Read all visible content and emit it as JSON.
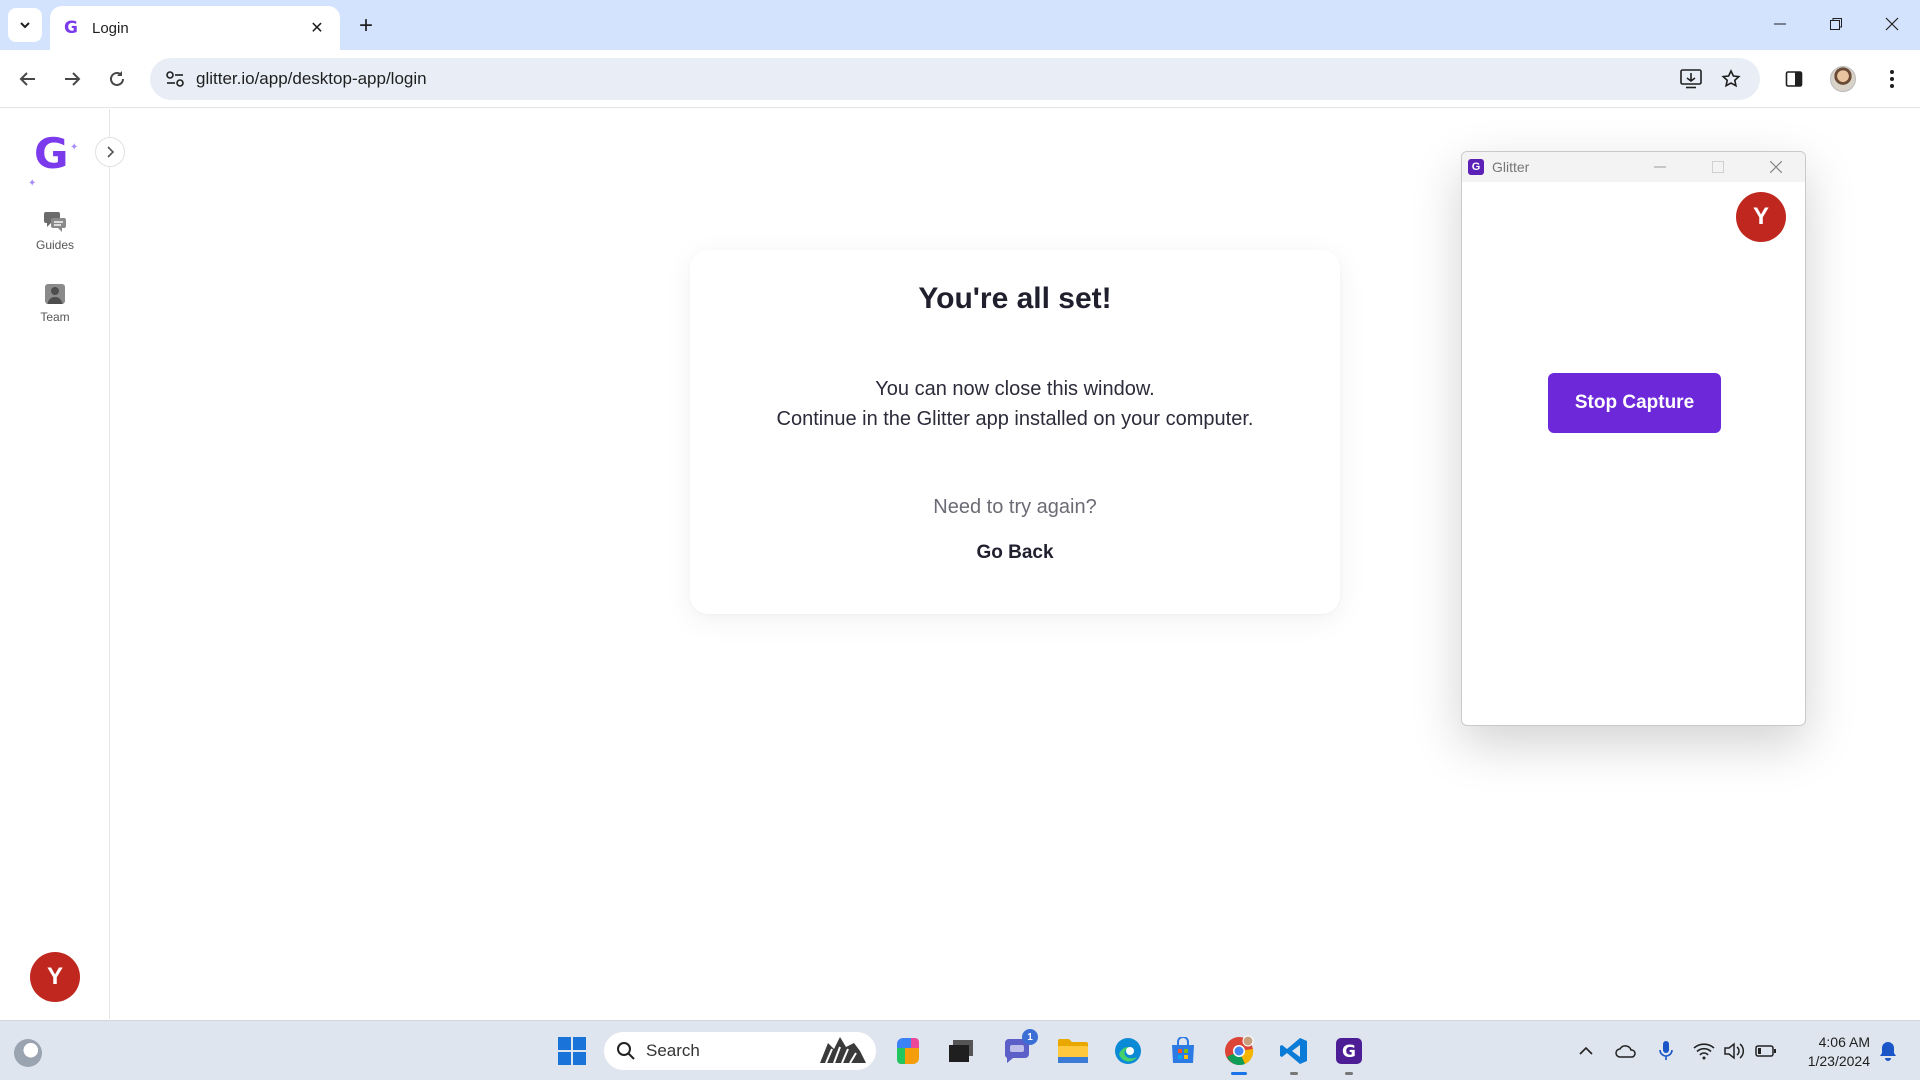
{
  "browser": {
    "tab": {
      "title": "Login",
      "favicon": "glitter-g"
    },
    "url": "glitter.io/app/desktop-app/login"
  },
  "sidebar": {
    "items": [
      {
        "label": "Guides",
        "icon": "chat-bubbles-icon"
      },
      {
        "label": "Team",
        "icon": "person-icon"
      }
    ],
    "avatar_initial": "Y"
  },
  "card": {
    "title": "You're all set!",
    "line1": "You can now close this window.",
    "line2": "Continue in the Glitter app installed on your computer.",
    "question": "Need to try again?",
    "link": "Go Back"
  },
  "glitter_window": {
    "title": "Glitter",
    "avatar_initial": "Y",
    "button_label": "Stop Capture"
  },
  "taskbar": {
    "search_placeholder": "Search",
    "chat_badge": "1",
    "time": "4:06 AM",
    "date": "1/23/2024"
  },
  "colors": {
    "accent": "#6d28d9",
    "avatar": "#c0281f",
    "tabstrip": "#d3e3fd"
  }
}
